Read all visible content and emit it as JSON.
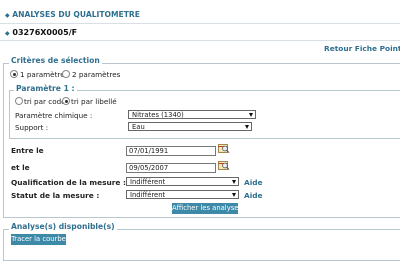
{
  "section_title": "ANALYSES DU QUALITOMETRE",
  "station_code": "03276X0005/F",
  "return_link": "Retour Fiche Point ea",
  "selection": {
    "legend": "Critères de sélection",
    "radio_one": "1 paramètre",
    "radio_two": "2 paramètres",
    "selected": "1 paramètre"
  },
  "param1": {
    "legend": "Paramètre 1 :",
    "sort_code": "tri par code",
    "sort_libelle": "tri par libellé",
    "sort_selected": "tri par libellé",
    "chem_label": "Paramètre chimique :",
    "chem_value": "Nitrates (1340)",
    "support_label": "Support :",
    "support_value": "Eau"
  },
  "dates": {
    "start_label": "Entre le",
    "start_value": "07/01/1991",
    "end_label": "et le",
    "end_value": "09/05/2007"
  },
  "qualification": {
    "label": "Qualification de la mesure :",
    "value": "Indifférent",
    "help": "Aide"
  },
  "status": {
    "label": "Statut de la mesure :",
    "value": "Indifférent",
    "help": "Aide"
  },
  "show_button": "Afficher les analyses",
  "available": {
    "legend": "Analyse(s) disponible(s)",
    "chart_button": "Tracer la courbe"
  },
  "colors": {
    "accent": "#2f6f8f",
    "button": "#3d8aa8"
  }
}
